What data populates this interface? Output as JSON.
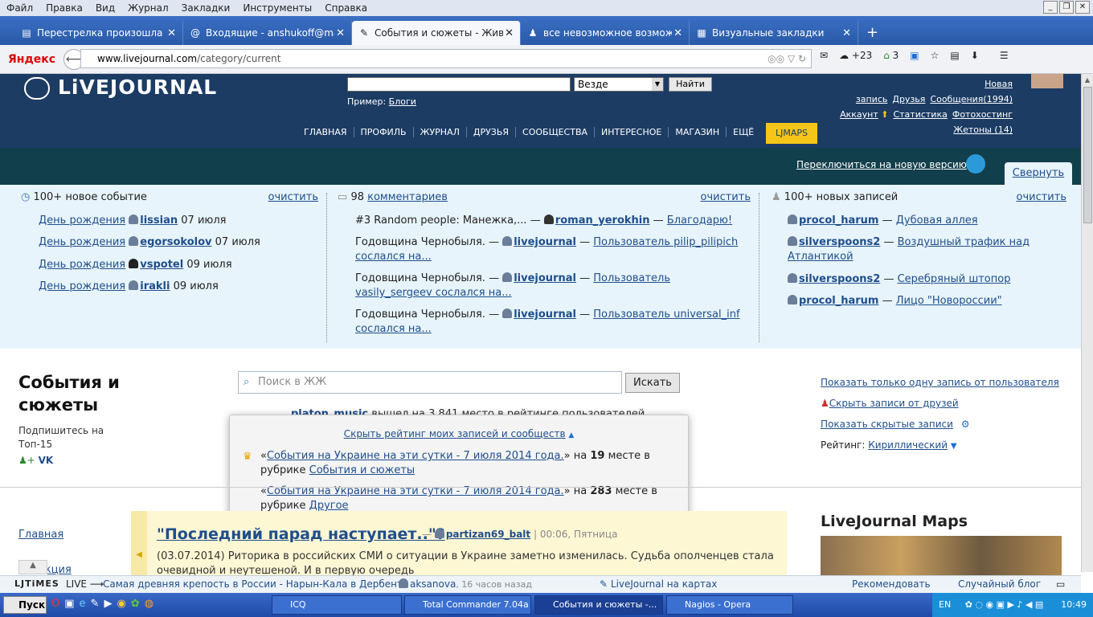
{
  "menu": [
    "Файл",
    "Правка",
    "Вид",
    "Журнал",
    "Закладки",
    "Инструменты",
    "Справка"
  ],
  "tabs": [
    {
      "title": "Перестрелка произошла на ...",
      "icon": "▤"
    },
    {
      "title": "Входящие - anshukoff@mail....",
      "icon": "@"
    },
    {
      "title": "События и сюжеты - Живой...",
      "icon": "✎"
    },
    {
      "title": "все невозможное возможно!...",
      "icon": "♟"
    },
    {
      "title": "Визуальные закладки",
      "icon": "▦"
    }
  ],
  "nav": {
    "brand": "Яндекс",
    "url_host": "www.livejournal.com",
    "url_path": "/category/current",
    "weather": "+23",
    "badge": "3"
  },
  "lj": {
    "logo": "LiVEJOURNAL",
    "where": "Везде",
    "find": "Найти",
    "example_label": "Пример:",
    "example_link": "Блоги",
    "topnav": [
      "ГЛАВНАЯ",
      "ПРОФИЛЬ",
      "ЖУРНАЛ",
      "ДРУЗЬЯ",
      "СООБЩЕСТВА",
      "ИНТЕРЕСНОЕ",
      "МАГАЗИН",
      "ЕЩЁ"
    ],
    "ljmaps": "LJMAPS",
    "user_links_row1": [
      "Новая запись",
      "Друзья",
      "Сообщения(1994)"
    ],
    "user_links_row2": [
      "Аккаунт",
      "Статистика",
      "Фотохостинг"
    ],
    "user_links_row3": [
      "Жетоны (14)"
    ],
    "switch": "Переключиться на новую версию",
    "collapse": "Свернуть"
  },
  "feed": {
    "col1": {
      "head": "100+ новое событие",
      "clear": "очистить",
      "rows": [
        {
          "event": "День рождения",
          "user": "lissian",
          "date": "07 июля"
        },
        {
          "event": "День рождения",
          "user": "egorsokolov",
          "date": "07 июля"
        },
        {
          "event": "День рождения",
          "user": "vspotel",
          "date": "09 июля"
        },
        {
          "event": "День рождения",
          "user": "irakli",
          "date": "09 июля"
        }
      ]
    },
    "col2": {
      "count": "98",
      "head": "комментариев",
      "clear": "очистить",
      "rows": [
        {
          "text": "#3 Random people: Манежка,... —",
          "user": "roman_yerokhin",
          "sep": "—",
          "link": "Благодарю!"
        },
        {
          "text": "Годовщина Чернобыля. —",
          "user": "livejournal",
          "sep": "—",
          "link": "Пользователь pilip_pilipich сослался на..."
        },
        {
          "text": "Годовщина Чернобыля. —",
          "user": "livejournal",
          "sep": "—",
          "link": "Пользователь vasily_sergeev сослался на..."
        },
        {
          "text": "Годовщина Чернобыля. —",
          "user": "livejournal",
          "sep": "—",
          "link": "Пользователь universal_inf сослался на..."
        }
      ]
    },
    "col3": {
      "head": "100+ новых записей",
      "clear": "очистить",
      "rows": [
        {
          "user": "procol_harum",
          "sep": "—",
          "link": "Дубовая аллея"
        },
        {
          "user": "silverspoons2",
          "sep": "—",
          "link": "Воздушный трафик над Атлантикой"
        },
        {
          "user": "silverspoons2",
          "sep": "—",
          "link": "Серебряный штопор"
        },
        {
          "user": "procol_harum",
          "sep": "—",
          "link": "Лицо \"Новороссии\""
        }
      ]
    }
  },
  "main": {
    "title": "События и сюжеты",
    "subscribe": "Подпишитесь на Топ-15",
    "search_placeholder": "Поиск в ЖЖ",
    "search_btn": "Искать",
    "opt1": "Показать только одну запись от пользователя",
    "opt2": "Скрыть записи от друзей",
    "opt3": "Показать скрытые записи",
    "rating_label": "Рейтинг:",
    "rating_value": "Кириллический",
    "behind_user": "platon_music",
    "behind_text": "вышел на 3 841 место в рейтинге пользователей",
    "popup": {
      "hide": "Скрыть рейтинг моих записей и сообществ",
      "r1_link": "События на Украине на эти сутки - 7 июля 2014 года.",
      "r1_pre": "на",
      "r1_num": "19",
      "r1_post": "месте в рубрике",
      "r1_cat": "События и сюжеты",
      "r2_link": "События на Украине на эти сутки - 7 июля 2014 года.",
      "r2_pre": "на",
      "r2_num": "283",
      "r2_post": "месте в рубрике",
      "r2_cat": "Другое"
    },
    "leftnav": [
      "Главная",
      "Редакция"
    ],
    "article": {
      "title": "\"Последний парад наступает..\"?",
      "author": "partizan69_balt",
      "meta": "| 00:06, Пятница",
      "text": "(03.07.2014) Риторика в российских СМИ о ситуации в Украине заметно изменилась. Судьба ополченцев стала очевидной и неутешеной. И в первую очередь"
    },
    "maps_title": "LiveJournal Maps"
  },
  "ljbar": {
    "logo": "LJTiMES",
    "live": "LIVE ⟶",
    "news": "Самая древняя крепость в России - Нарын-Кала в Дербенте",
    "user": "aksanova",
    "ago": ", 16 часов назад",
    "maps": "LiveJournal на картах",
    "recommend": "Рекомендовать",
    "random": "Случайный блог"
  },
  "taskbar": {
    "start": "Пуск",
    "items": [
      "ICQ",
      "Total Commander 7.04a ...",
      "События и сюжеты -...",
      "Nagios - Opera"
    ],
    "lang": "EN",
    "time": "10:49"
  }
}
